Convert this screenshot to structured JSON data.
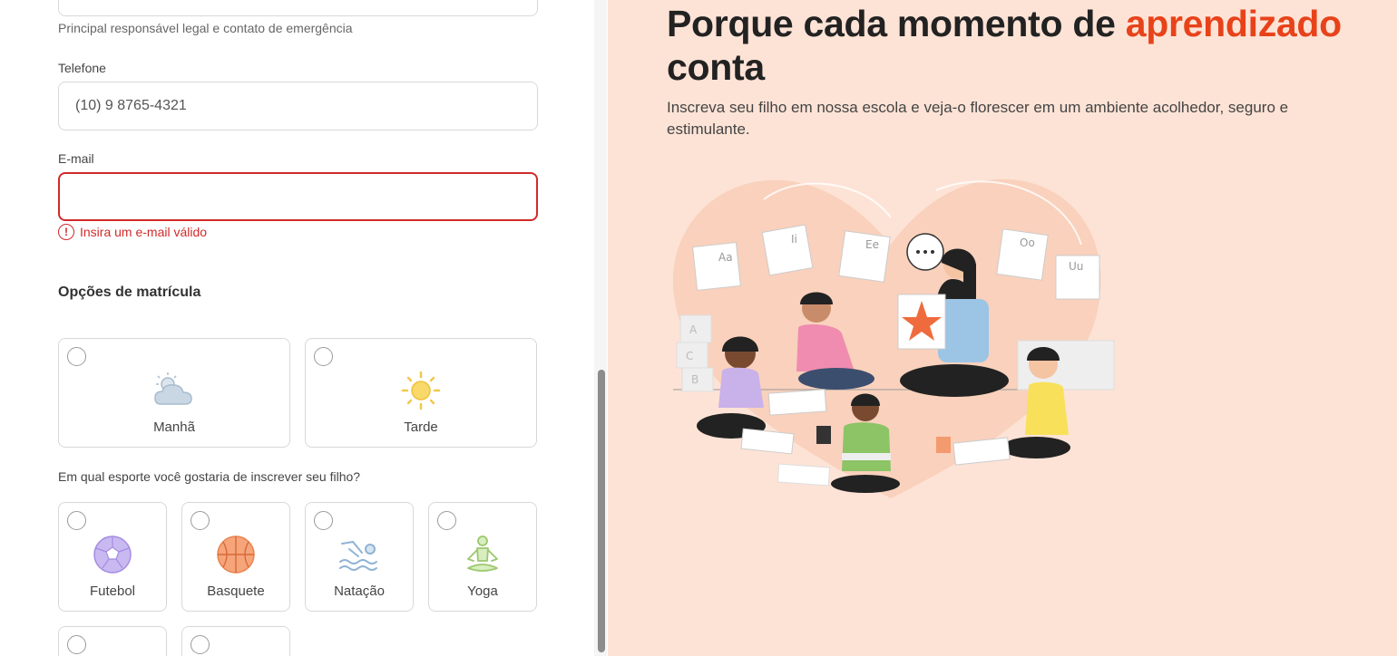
{
  "form": {
    "guardian_helper": "Principal responsável legal e contato de emergência",
    "phone": {
      "label": "Telefone",
      "value": "(10) 9 8765-4321"
    },
    "email": {
      "label": "E-mail",
      "value": "",
      "error": "Insira um e-mail válido"
    },
    "enrollment": {
      "title": "Opções de matrícula",
      "shifts": [
        {
          "label": "Manhã",
          "icon": "cloud-sun-icon",
          "selected": false
        },
        {
          "label": "Tarde",
          "icon": "sun-icon",
          "selected": false
        }
      ],
      "sports_question": "Em qual esporte você gostaria de inscrever seu filho?",
      "sports": [
        {
          "label": "Futebol",
          "icon": "soccer-ball-icon",
          "selected": false
        },
        {
          "label": "Basquete",
          "icon": "basketball-icon",
          "selected": false
        },
        {
          "label": "Natação",
          "icon": "swimmer-icon",
          "selected": false
        },
        {
          "label": "Yoga",
          "icon": "yoga-icon",
          "selected": false
        }
      ]
    }
  },
  "hero": {
    "headline_part1": "Porque cada momento de ",
    "headline_accent": "aprendizado",
    "headline_part2": "conta",
    "subtitle": "Inscreva seu filho em nossa escola e veja-o florescer em um ambiente acolhedor, seguro e estimulante.",
    "illustration_letters": [
      "Aa",
      "Ii",
      "Ee",
      "Oo",
      "Uu",
      "A",
      "C",
      "B"
    ]
  },
  "colors": {
    "accent": "#e8421a",
    "error": "#d12a2a",
    "hero_bg": "#fde3d6"
  }
}
